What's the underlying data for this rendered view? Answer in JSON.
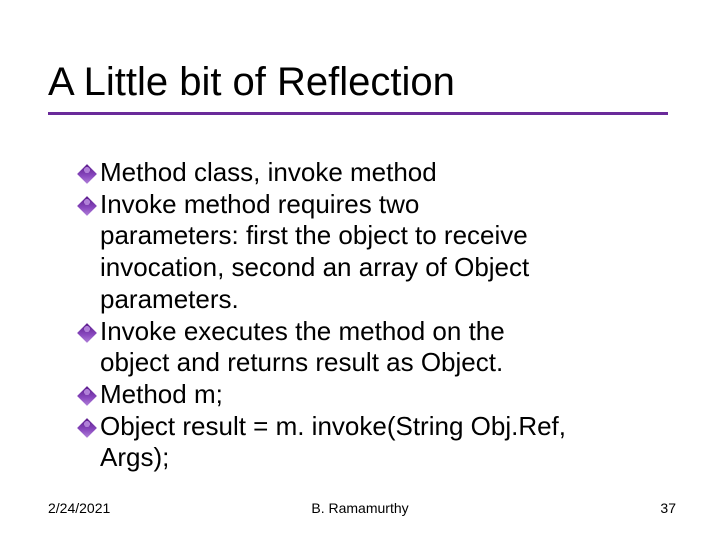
{
  "title": "A Little bit of Reflection",
  "bullets": {
    "b0": "Method class, invoke method",
    "b1": "Invoke method requires two",
    "b1_c1": "parameters: first the object to receive",
    "b1_c2": "invocation, second an array of Object",
    "b1_c3": "parameters.",
    "b2": "Invoke executes the method on the",
    "b2_c1": "object and returns result as Object.",
    "b3": "Method m;",
    "b4": "Object result = m. invoke(String Obj.Ref,",
    "b4_c1": "Args);"
  },
  "footer": {
    "date": "2/24/2021",
    "center": "B. Ramamurthy",
    "page": "37"
  }
}
